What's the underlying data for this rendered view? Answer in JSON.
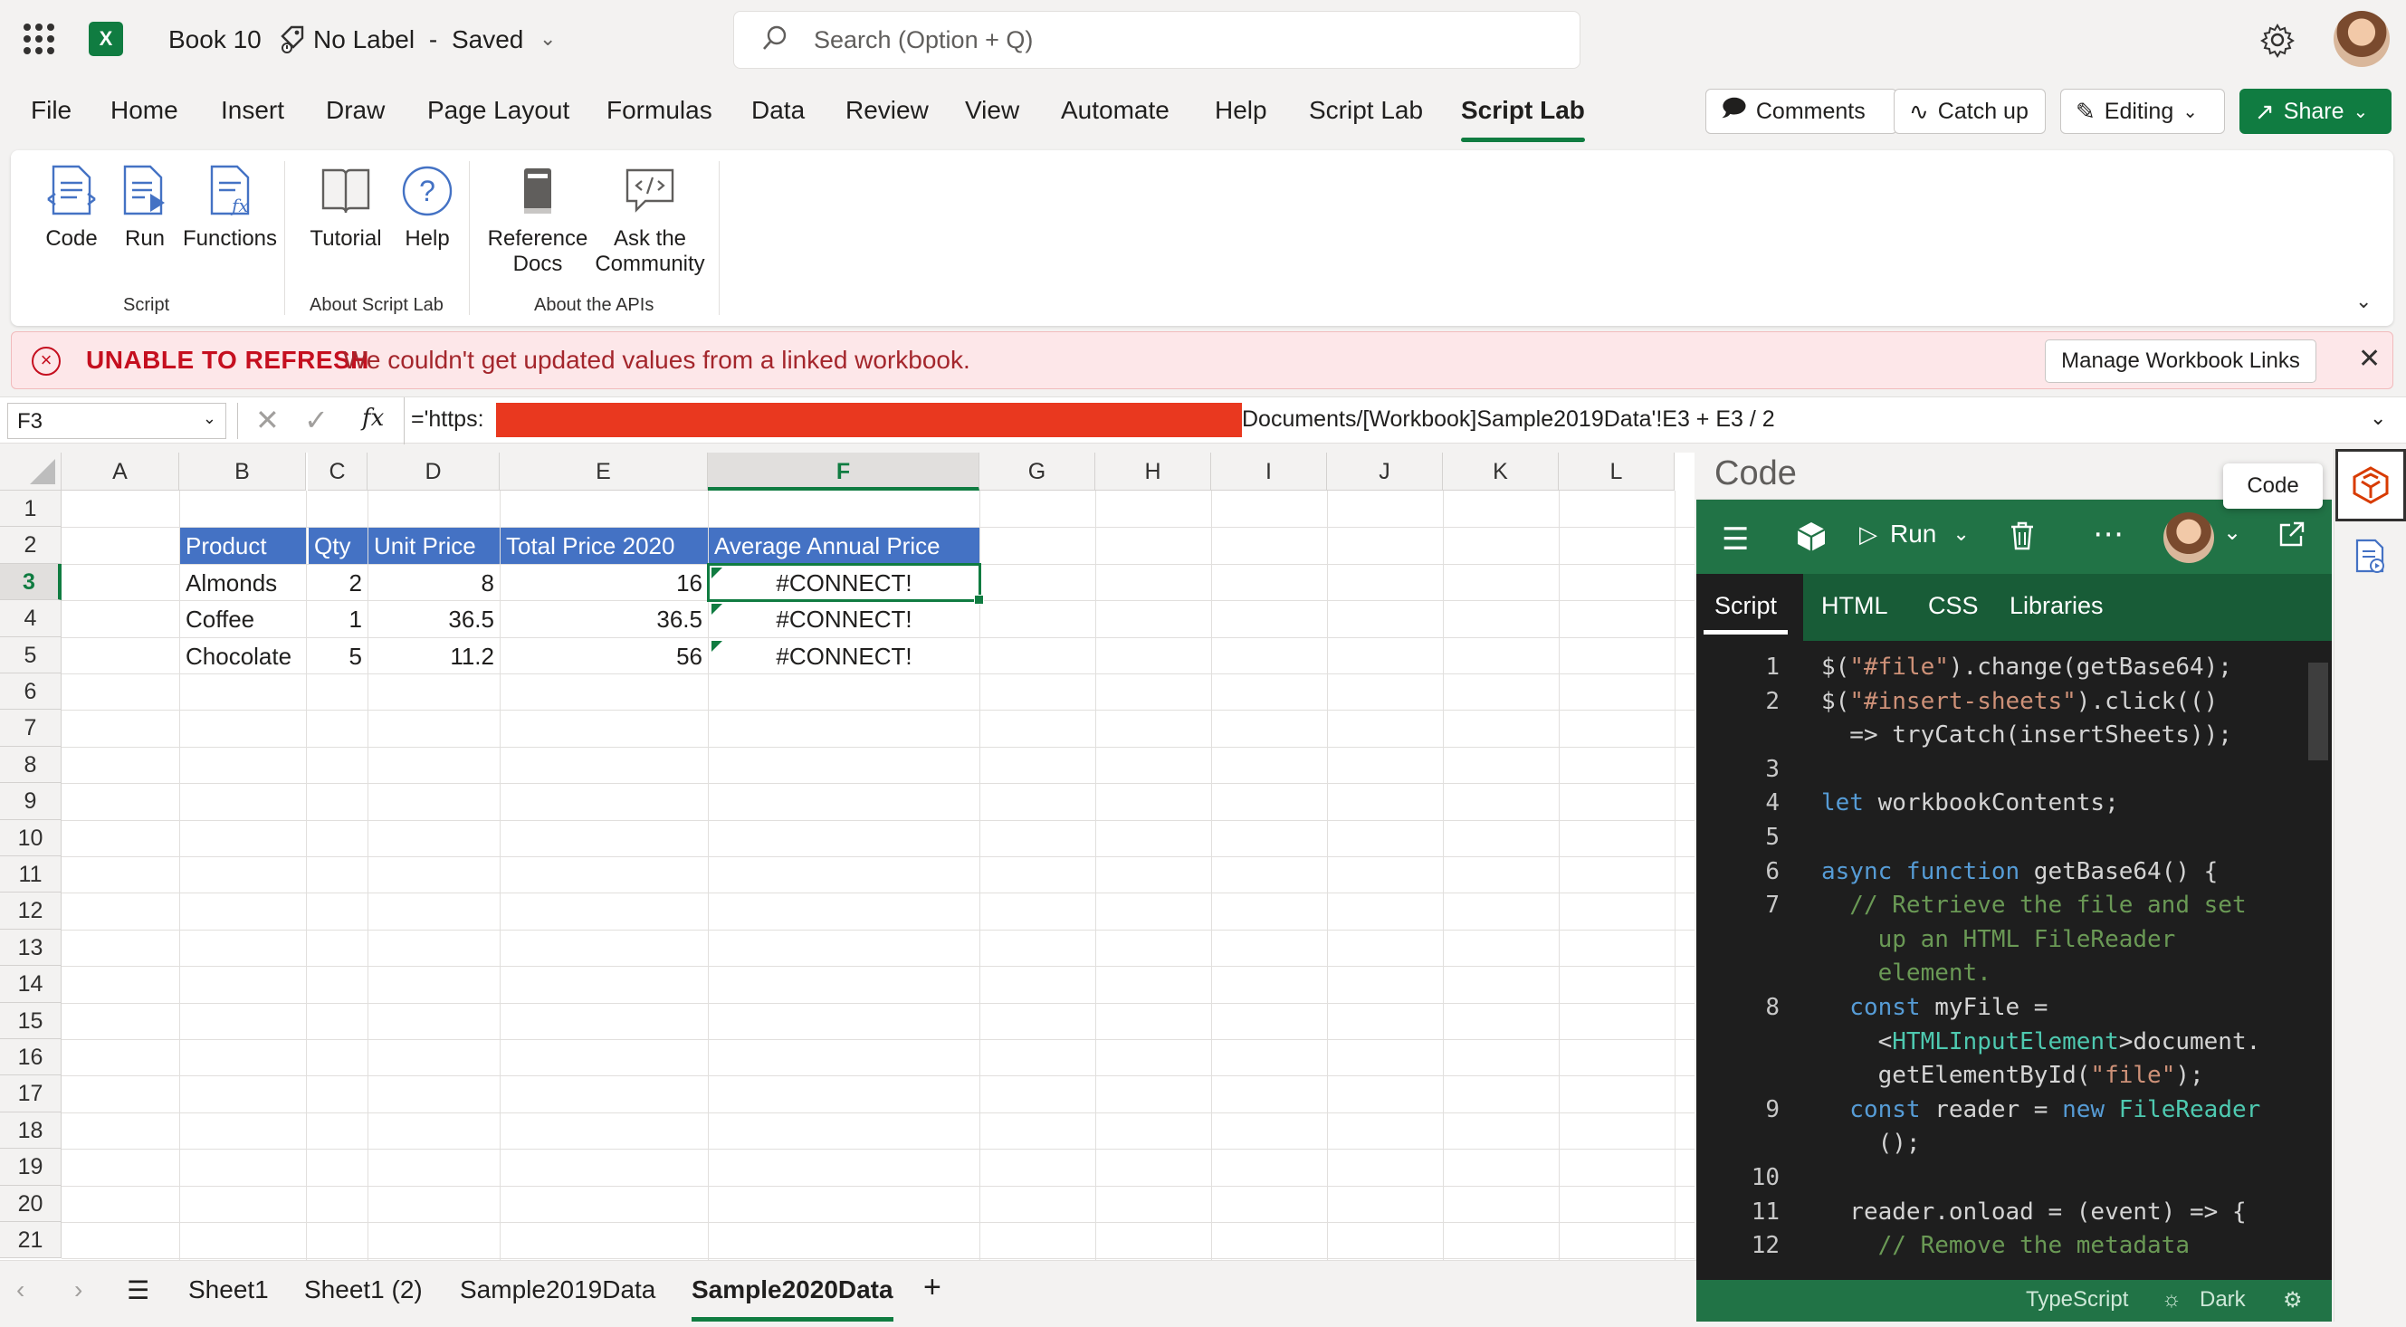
{
  "titlebar": {
    "doc_name": "Book 10",
    "label": "No Label",
    "separator": "-",
    "save_status": "Saved",
    "search_placeholder": "Search (Option + Q)"
  },
  "tabs": [
    "File",
    "Home",
    "Insert",
    "Draw",
    "Page Layout",
    "Formulas",
    "Data",
    "Review",
    "View",
    "Automate",
    "Help",
    "Script Lab",
    "Script Lab"
  ],
  "active_tab_index": 12,
  "ribbon_actions": {
    "comments": "Comments",
    "catch_up": "Catch up",
    "editing": "Editing",
    "share": "Share"
  },
  "ribbon": {
    "script": {
      "code": "Code",
      "run": "Run",
      "functions": "Functions",
      "group": "Script"
    },
    "about": {
      "tutorial": "Tutorial",
      "help": "Help",
      "group": "About Script Lab"
    },
    "apis": {
      "ref_l1": "Reference",
      "ref_l2": "Docs",
      "ask_l1": "Ask the",
      "ask_l2": "Community",
      "group": "About the APIs"
    }
  },
  "error": {
    "title": "UNABLE TO REFRESH",
    "message": "We couldn't get updated values from a linked workbook.",
    "button": "Manage Workbook Links"
  },
  "formula_bar": {
    "name_box": "F3",
    "formula_start": "='https:",
    "formula_end": "Documents/[Workbook]Sample2019Data'!E3 + E3 / 2"
  },
  "columns": [
    "A",
    "B",
    "C",
    "D",
    "E",
    "F",
    "G",
    "H",
    "I",
    "J",
    "K",
    "L"
  ],
  "rows": [
    "1",
    "2",
    "3",
    "4",
    "5",
    "6",
    "7",
    "8",
    "9",
    "10",
    "11",
    "12",
    "13",
    "14",
    "15",
    "16",
    "17",
    "18",
    "19",
    "20",
    "21"
  ],
  "table": {
    "headers": [
      "Product",
      "Qty",
      "Unit Price",
      "Total Price 2020",
      "Average Annual Price"
    ],
    "data": [
      [
        "Almonds",
        "2",
        "8",
        "16",
        "#CONNECT!"
      ],
      [
        "Coffee",
        "1",
        "36.5",
        "36.5",
        "#CONNECT!"
      ],
      [
        "Chocolate",
        "5",
        "11.2",
        "56",
        "#CONNECT!"
      ]
    ]
  },
  "code_pane": {
    "title": "Code",
    "run": "Run",
    "tabs": [
      "Script",
      "HTML",
      "CSS",
      "Libraries"
    ],
    "tooltip": "Code",
    "status": {
      "language": "TypeScript",
      "theme": "Dark"
    }
  },
  "code_lines": [
    {
      "n": "1",
      "parts": [
        [
          "$(",
          ""
        ],
        [
          "\"#file\"",
          "s"
        ],
        [
          ").change(getBase64);",
          ""
        ]
      ]
    },
    {
      "n": "2",
      "parts": [
        [
          "$(",
          ""
        ],
        [
          "\"#insert-sheets\"",
          "s"
        ],
        [
          ").click(()",
          ""
        ]
      ]
    },
    {
      "n": "",
      "parts": [
        [
          "  => tryCatch(insertSheets));",
          ""
        ]
      ]
    },
    {
      "n": "3",
      "parts": []
    },
    {
      "n": "4",
      "parts": [
        [
          "let",
          "k"
        ],
        [
          " workbookContents;",
          ""
        ]
      ]
    },
    {
      "n": "5",
      "parts": []
    },
    {
      "n": "6",
      "parts": [
        [
          "async function",
          "k"
        ],
        [
          " getBase64() {",
          ""
        ]
      ]
    },
    {
      "n": "7",
      "parts": [
        [
          "  // Retrieve the file and set",
          "c"
        ]
      ]
    },
    {
      "n": "",
      "parts": [
        [
          "    up an HTML FileReader",
          "c"
        ]
      ]
    },
    {
      "n": "",
      "parts": [
        [
          "    element.",
          "c"
        ]
      ]
    },
    {
      "n": "8",
      "parts": [
        [
          "  const",
          "k"
        ],
        [
          " myFile =",
          ""
        ]
      ]
    },
    {
      "n": "",
      "parts": [
        [
          "    <",
          ""
        ],
        [
          "HTMLInputElement",
          "t"
        ],
        [
          ">document.",
          ""
        ]
      ]
    },
    {
      "n": "",
      "parts": [
        [
          "    getElementById(",
          ""
        ],
        [
          "\"file\"",
          "s"
        ],
        [
          ");",
          ""
        ]
      ]
    },
    {
      "n": "9",
      "parts": [
        [
          "  const",
          "k"
        ],
        [
          " reader = ",
          ""
        ],
        [
          "new",
          "k"
        ],
        [
          " ",
          ""
        ],
        [
          "FileReader",
          "t"
        ]
      ]
    },
    {
      "n": "",
      "parts": [
        [
          "    ();",
          ""
        ]
      ]
    },
    {
      "n": "10",
      "parts": []
    },
    {
      "n": "11",
      "parts": [
        [
          "  reader.onload = (event) => {",
          ""
        ]
      ]
    },
    {
      "n": "12",
      "parts": [
        [
          "    // Remove the metadata",
          "c"
        ]
      ]
    }
  ],
  "sheet_tabs": [
    "Sheet1",
    "Sheet1 (2)",
    "Sample2019Data",
    "Sample2020Data"
  ],
  "active_sheet_index": 3
}
